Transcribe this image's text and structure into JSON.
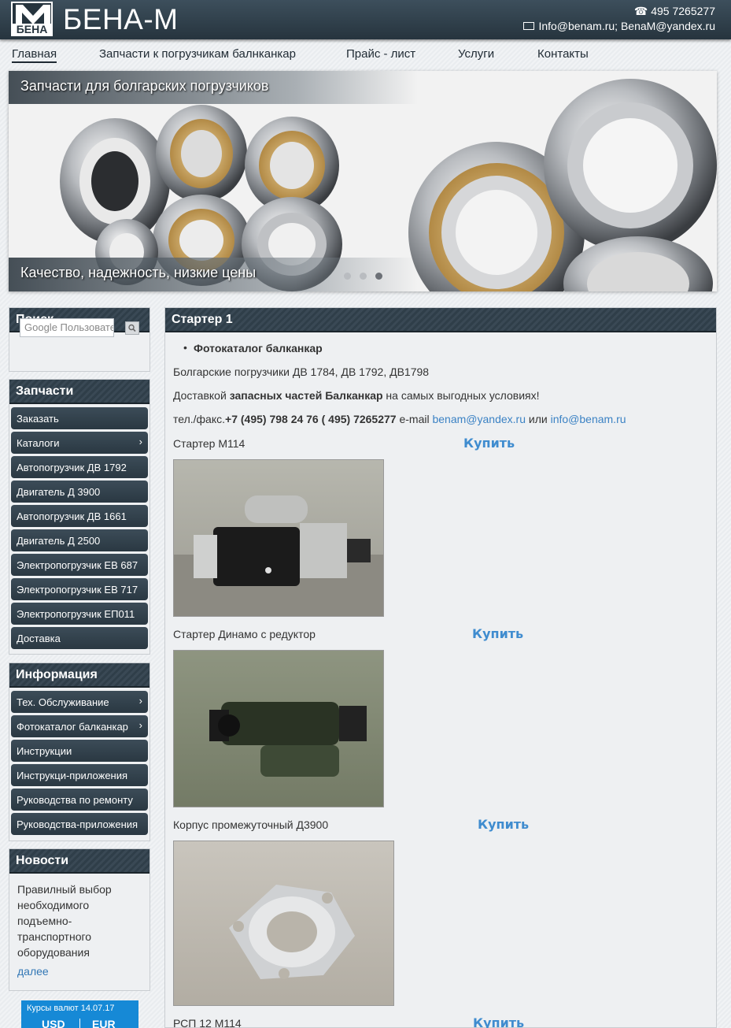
{
  "header": {
    "logo_text": "БЕНА",
    "brand_name": "БЕНА-М",
    "phone": "495 7265277",
    "emails": "Info@benam.ru; BenaM@yandex.ru"
  },
  "nav": {
    "items": [
      "Главная",
      "Запчасти к погрузчикам балнканкар",
      "Прайс - лист",
      "Услуги",
      "Контакты"
    ]
  },
  "slider": {
    "title": "Запчасти для болгарских погрузчиков",
    "caption": "Качество, надежность, низкие цены",
    "dots": 3,
    "active_dot": 3
  },
  "sidebar": {
    "search": {
      "title": "Поиск",
      "placeholder": "Google Пользовательский поиск"
    },
    "parts": {
      "title": "Запчасти",
      "items": [
        {
          "label": "Заказать",
          "has_children": false
        },
        {
          "label": "Каталоги",
          "has_children": true
        },
        {
          "label": "Автопогрузчик ДВ 1792",
          "has_children": false
        },
        {
          "label": "Двигатель Д 3900",
          "has_children": false
        },
        {
          "label": "Автопогрузчик ДВ 1661",
          "has_children": false
        },
        {
          "label": "Двигатель Д 2500",
          "has_children": false
        },
        {
          "label": "Электропогрузчик ЕВ 687",
          "has_children": false
        },
        {
          "label": "Электропогрузчик ЕВ 717",
          "has_children": false
        },
        {
          "label": "Электропогрузчик ЕП011",
          "has_children": false
        },
        {
          "label": "Доставка",
          "has_children": false
        }
      ]
    },
    "info": {
      "title": "Информация",
      "items": [
        {
          "label": "Тех. Обслуживание",
          "has_children": true
        },
        {
          "label": "Фотокаталог балканкар",
          "has_children": true
        },
        {
          "label": "Инструкции",
          "has_children": false
        },
        {
          "label": "Инструкци-приложения",
          "has_children": false
        },
        {
          "label": "Руководства по ремонту",
          "has_children": false
        },
        {
          "label": "Руководства-приложения",
          "has_children": false
        }
      ]
    },
    "news": {
      "title": "Новости",
      "text": "Правилный выбор необходимого подъемно-транспортного оборудования",
      "more": "далее"
    },
    "currency": {
      "title": "Курсы валют 14.07.17",
      "usd": "USD",
      "eur": "EUR"
    }
  },
  "main": {
    "title": "Стартер 1",
    "bullet": "Фотокаталог балканкар",
    "line1": "Болгарские погрузчики ДВ 1784,  ДВ 1792, ДВ1798",
    "line2_pre": "Доставкой ",
    "line2_bold": "запасных частей Балканкар",
    "line2_post": " на самых выгодных условиях!",
    "contact_pre": "тел./факс.",
    "contact_bold": "+7 (495) 798 24 76  ( 495) 7265277",
    "contact_email_label": "  e-mail ",
    "email1": "benam@yandex.ru",
    "contact_or": "  или ",
    "email2": "info@benam.ru",
    "products": [
      {
        "name": "Стартер М114",
        "buy": "Купить"
      },
      {
        "name": "Стартер Динамо с редуктор",
        "buy": "Купить"
      },
      {
        "name": "Корпус промежуточный Д3900",
        "buy": "Купить"
      },
      {
        "name": "РСП 12 М114",
        "buy": "Купить"
      }
    ]
  },
  "colors": {
    "header_bg": "#2d3c47",
    "menu_bg": "#34444f",
    "link": "#3b82c4",
    "buy": "#3f8ccf",
    "currency_bg": "#1689d6"
  }
}
